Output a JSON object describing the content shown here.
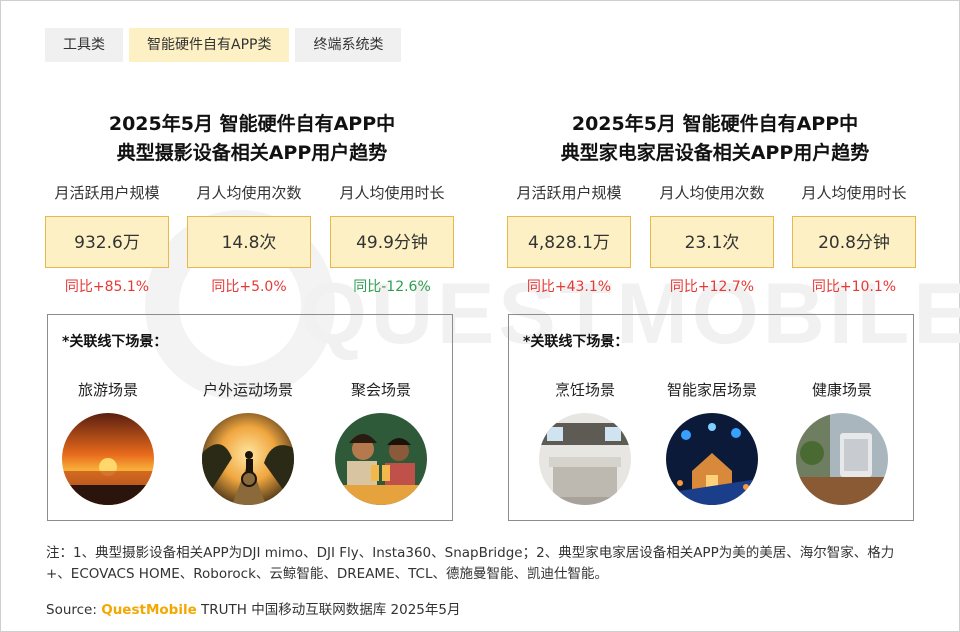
{
  "tabs": [
    {
      "label": "工具类",
      "active": false
    },
    {
      "label": "智能硬件自有APP类",
      "active": true
    },
    {
      "label": "终端系统类",
      "active": false
    }
  ],
  "watermark": "QUESTMOBILE",
  "left_panel": {
    "title_line1": "2025年5月 智能硬件自有APP中",
    "title_line2": "典型摄影设备相关APP用户趋势",
    "metrics": [
      {
        "label": "月活跃用户规模",
        "value": "932.6万",
        "yoy": "同比+85.1%",
        "trend": "up"
      },
      {
        "label": "月人均使用次数",
        "value": "14.8次",
        "yoy": "同比+5.0%",
        "trend": "up"
      },
      {
        "label": "月人均使用时长",
        "value": "49.9分钟",
        "yoy": "同比-12.6%",
        "trend": "down"
      }
    ],
    "scenes_heading": "*关联线下场景：",
    "scenes": [
      {
        "label": "旅游场景",
        "icon": "sunset-photo"
      },
      {
        "label": "户外运动场景",
        "icon": "cyclist-photo"
      },
      {
        "label": "聚会场景",
        "icon": "party-photo"
      }
    ]
  },
  "right_panel": {
    "title_line1": "2025年5月 智能硬件自有APP中",
    "title_line2": "典型家电家居设备相关APP用户趋势",
    "metrics": [
      {
        "label": "月活跃用户规模",
        "value": "4,828.1万",
        "yoy": "同比+43.1%",
        "trend": "up"
      },
      {
        "label": "月人均使用次数",
        "value": "23.1次",
        "yoy": "同比+12.7%",
        "trend": "up"
      },
      {
        "label": "月人均使用时长",
        "value": "20.8分钟",
        "yoy": "同比+10.1%",
        "trend": "up"
      }
    ],
    "scenes_heading": "*关联线下场景：",
    "scenes": [
      {
        "label": "烹饪场景",
        "icon": "kitchen-photo"
      },
      {
        "label": "智能家居场景",
        "icon": "smart-home-photo"
      },
      {
        "label": "健康场景",
        "icon": "air-purifier-photo"
      }
    ]
  },
  "colors": {
    "accent_fill": "#fdf0c4",
    "accent_border": "#e8b948",
    "up": "#e53935",
    "down": "#2e9e4f",
    "brand": "#f2a800"
  },
  "note": "注：1、典型摄影设备相关APP为DJI mimo、DJI Fly、Insta360、SnapBridge；2、典型家电家居设备相关APP为美的美居、海尔智家、格力+、ECOVACS HOME、Roborock、云鲸智能、DREAME、TCL、德施曼智能、凯迪仕智能。",
  "source": {
    "prefix": "Source: ",
    "brand": "QuestMobile",
    "suffix": " TRUTH 中国移动互联网数据库 2025年5月"
  }
}
